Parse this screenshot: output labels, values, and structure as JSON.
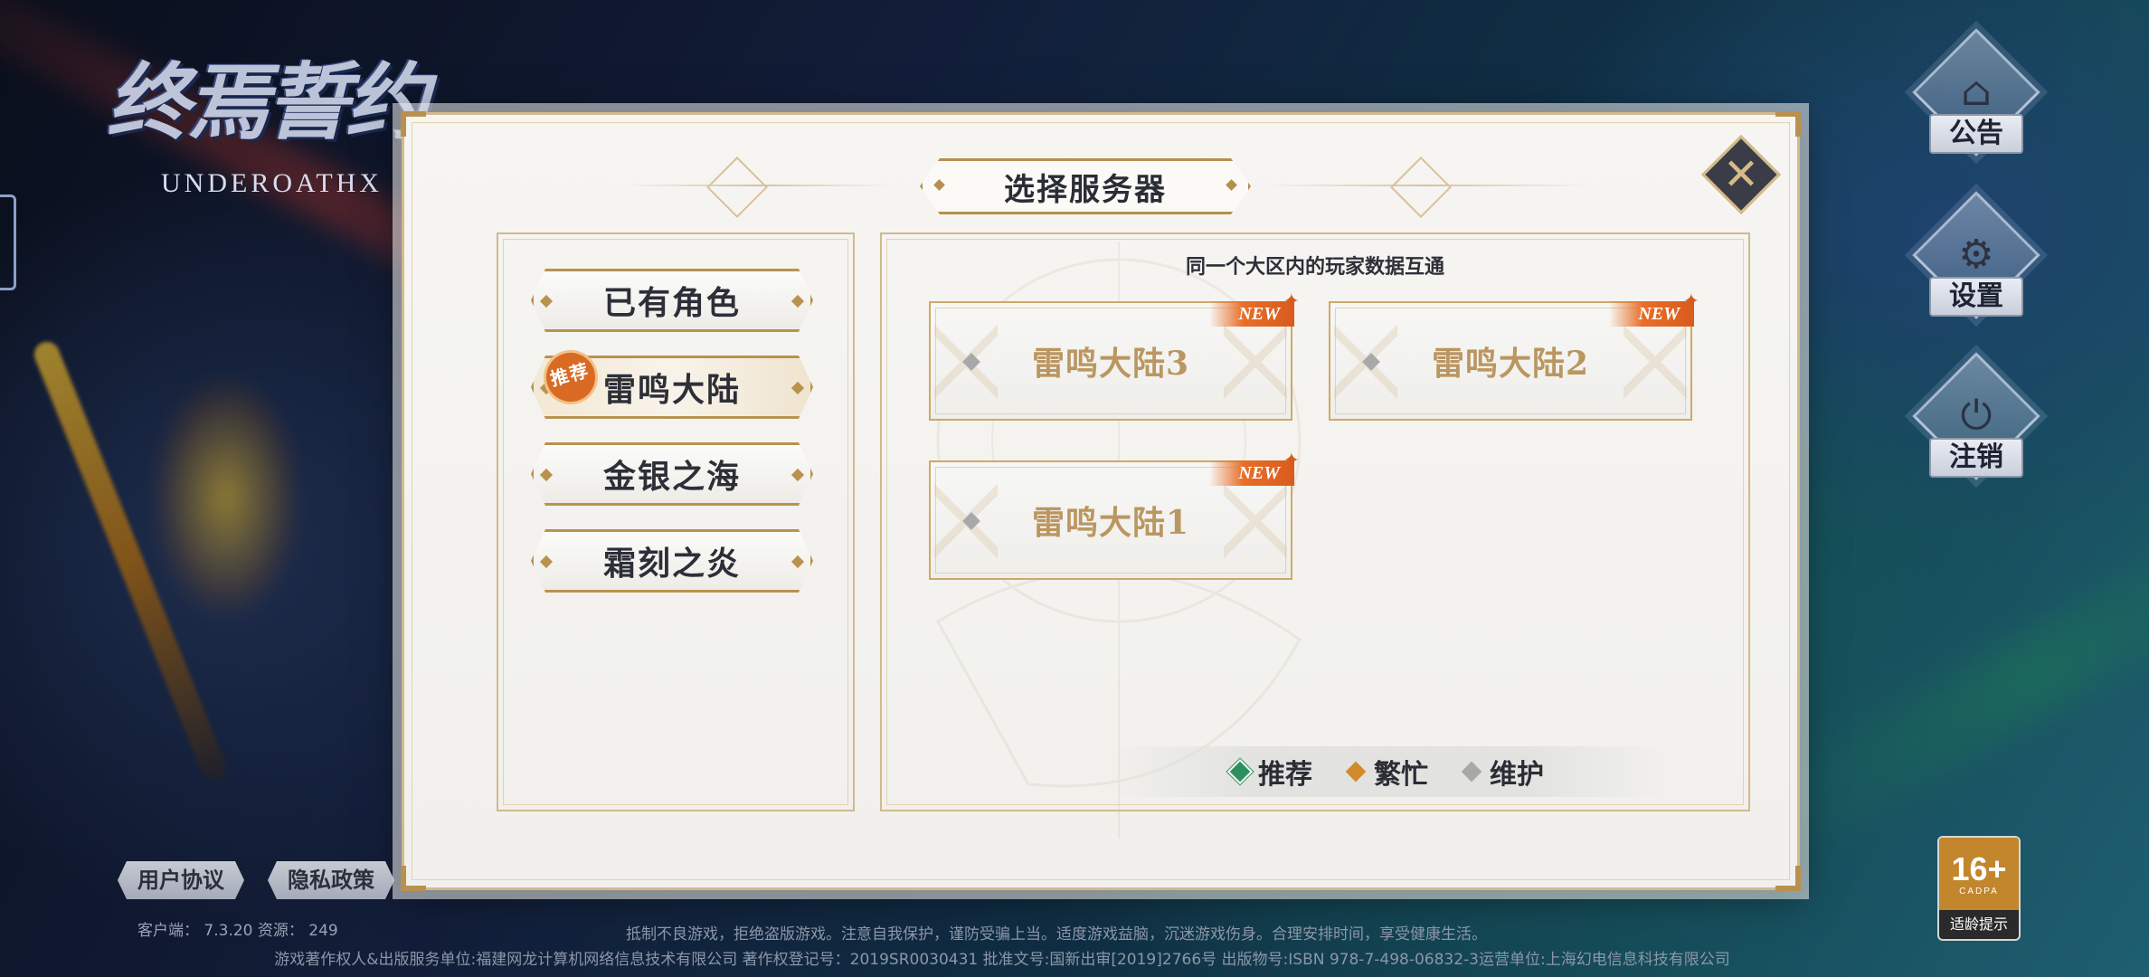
{
  "logo": {
    "cn": "终焉誓约",
    "en": "UNDEROATHX"
  },
  "side_menu": [
    {
      "label": "公告",
      "icon": "announcement-icon"
    },
    {
      "label": "设置",
      "icon": "gear-icon"
    },
    {
      "label": "注销",
      "icon": "power-icon"
    }
  ],
  "dialog": {
    "title": "选择服务器",
    "hint": "同一个大区内的玩家数据互通",
    "close_icon": "close-icon",
    "regions": [
      {
        "label": "已有角色"
      },
      {
        "label": "雷鸣大陆",
        "badge": "推荐",
        "selected": true
      },
      {
        "label": "金银之海"
      },
      {
        "label": "霜刻之炎"
      }
    ],
    "servers": [
      {
        "name": "雷鸣大陆3",
        "tag": "NEW",
        "status": "维护"
      },
      {
        "name": "雷鸣大陆2",
        "tag": "NEW",
        "status": "维护"
      },
      {
        "name": "雷鸣大陆1",
        "tag": "NEW",
        "status": "维护"
      }
    ],
    "legend": [
      {
        "label": "推荐",
        "color": "#2e8f5e"
      },
      {
        "label": "繁忙",
        "color": "#d08a2a"
      },
      {
        "label": "维护",
        "color": "#a8a8a8"
      }
    ]
  },
  "footer": {
    "user_agreement": "用户协议",
    "privacy_policy": "隐私政策",
    "version": "客户端： 7.3.20 资源： 249",
    "legal_line1": "抵制不良游戏，拒绝盗版游戏。注意自我保护，谨防受骗上当。适度游戏益脑，沉迷游戏伤身。合理安排时间，享受健康生活。",
    "legal_line2": "游戏著作权人&出版服务单位:福建网龙计算机网络信息技术有限公司 著作权登记号：2019SR0030431 批准文号:国新出审[2019]2766号 出版物号:ISBN 978-7-498-06832-3运营单位:上海幻电信息科技有限公司"
  },
  "age_rating": {
    "value": "16+",
    "org": "CADPA",
    "label": "适龄提示"
  }
}
